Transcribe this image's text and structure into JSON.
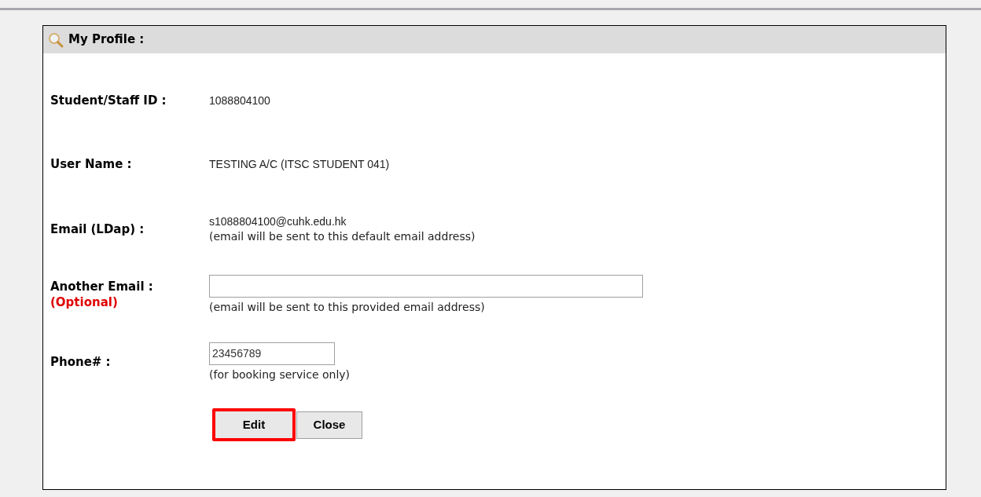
{
  "panel": {
    "title": "My Profile :"
  },
  "fields": [
    {
      "kind": "text",
      "label": "Student/Staff ID :",
      "value": "1088804100"
    },
    {
      "kind": "text",
      "label": "User Name :",
      "value": "TESTING A/C (ITSC STUDENT 041)"
    },
    {
      "kind": "text",
      "label": "Email (LDap) :",
      "value": "s1088804100@cuhk.edu.hk",
      "note": "(email will be sent to this default email address)"
    },
    {
      "kind": "long_input",
      "label": "Another Email :",
      "sublabel": "(Optional)",
      "note": "(email will be sent to this provided email address)"
    },
    {
      "kind": "short_input",
      "label": "Phone# :",
      "value": "23456789",
      "note": "(for booking service only)"
    }
  ],
  "buttons": [
    {
      "label": "Edit",
      "highlighted": true
    },
    {
      "label": "Close",
      "highlighted": false
    }
  ]
}
